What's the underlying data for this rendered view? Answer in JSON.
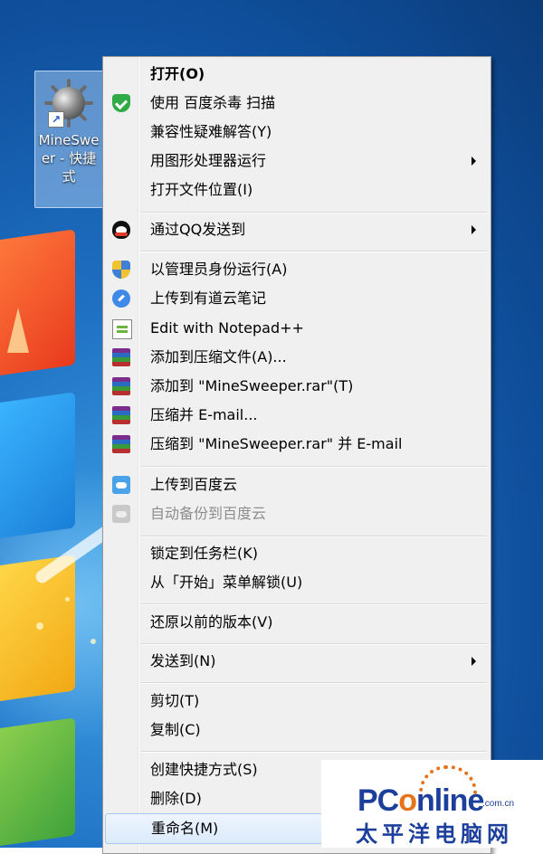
{
  "desktop": {
    "shortcut_label": "MineSweeper - 快捷方式",
    "shortcut_label_lines": [
      "MineSwe",
      "er - 快捷",
      "式"
    ]
  },
  "menu": {
    "items": [
      {
        "label": "打开(O)",
        "bold": true,
        "icon": "none"
      },
      {
        "label": "使用 百度杀毒 扫描",
        "icon": "baidu-antivirus-shield-icon"
      },
      {
        "label": "兼容性疑难解答(Y)",
        "icon": "none"
      },
      {
        "label": "用图形处理器运行",
        "icon": "none",
        "submenu": true
      },
      {
        "label": "打开文件位置(I)",
        "icon": "none"
      },
      {
        "label": "通过QQ发送到",
        "icon": "qq-penguin-icon",
        "submenu": true
      },
      {
        "label": "以管理员身份运行(A)",
        "icon": "uac-shield-icon"
      },
      {
        "label": "上传到有道云笔记",
        "icon": "youdao-note-icon"
      },
      {
        "label": "Edit with Notepad++",
        "icon": "notepad-plus-plus-icon"
      },
      {
        "label": "添加到压缩文件(A)...",
        "icon": "winrar-icon"
      },
      {
        "label": "添加到 \"MineSweeper.rar\"(T)",
        "icon": "winrar-icon"
      },
      {
        "label": "压缩并 E-mail...",
        "icon": "winrar-icon"
      },
      {
        "label": "压缩到 \"MineSweeper.rar\" 并 E-mail",
        "icon": "winrar-icon"
      },
      {
        "label": "上传到百度云",
        "icon": "baidu-cloud-icon"
      },
      {
        "label": "自动备份到百度云",
        "icon": "baidu-cloud-disabled-icon",
        "disabled": true
      },
      {
        "label": "锁定到任务栏(K)",
        "icon": "none"
      },
      {
        "label": "从「开始」菜单解锁(U)",
        "icon": "none"
      },
      {
        "label": "还原以前的版本(V)",
        "icon": "none"
      },
      {
        "label": "发送到(N)",
        "icon": "none",
        "submenu": true
      },
      {
        "label": "剪切(T)",
        "icon": "none"
      },
      {
        "label": "复制(C)",
        "icon": "none"
      },
      {
        "label": "创建快捷方式(S)",
        "icon": "none"
      },
      {
        "label": "删除(D)",
        "icon": "none"
      },
      {
        "label": "重命名(M)",
        "icon": "none",
        "highlighted": true
      }
    ]
  },
  "watermark": {
    "logo_prefix": "PC",
    "logo_o": "o",
    "logo_suffix": "nline",
    "domain": ".com.cn",
    "chinese": "太平洋电脑网"
  },
  "colors": {
    "menu_bg": "#f0f0f0",
    "highlight": "#dbeafb",
    "watermark_blue": "#1d3f9c",
    "watermark_orange": "#e8731a"
  }
}
